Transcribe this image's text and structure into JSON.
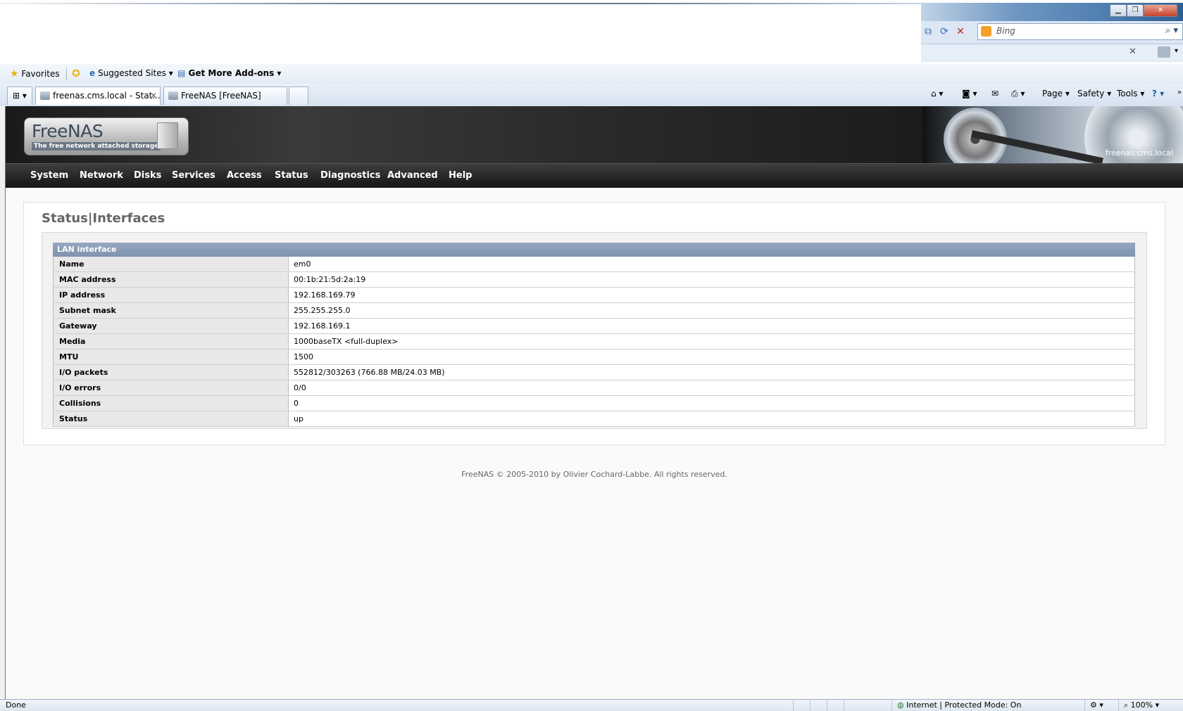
{
  "browser": {
    "search": {
      "placeholder": "Bing"
    },
    "favorites": {
      "favorites_label": "Favorites",
      "suggested_sites": "Suggested Sites",
      "get_addons": "Get More Add-ons"
    },
    "tabs": [
      {
        "label": "freenas.cms.local - Stat...",
        "close": "✕"
      },
      {
        "label": "FreeNAS [FreeNAS]"
      }
    ],
    "command_bar": {
      "page": "Page",
      "safety": "Safety",
      "tools": "Tools"
    },
    "status": {
      "left": "Done",
      "zone": "Internet | Protected Mode: On",
      "zoom": "100%"
    }
  },
  "app": {
    "logo_name": "FreeNAS",
    "logo_tagline": "The free network attached storage",
    "hostname": "freenas.cms.local",
    "nav": [
      "System",
      "Network",
      "Disks",
      "Services",
      "Access",
      "Status",
      "Diagnostics",
      "Advanced",
      "Help"
    ],
    "page_title": "Status|Interfaces",
    "table_title": "LAN interface",
    "rows": [
      {
        "key": "Name",
        "value": "em0"
      },
      {
        "key": "MAC address",
        "value": "00:1b:21:5d:2a:19"
      },
      {
        "key": "IP address",
        "value": "192.168.169.79"
      },
      {
        "key": "Subnet mask",
        "value": "255.255.255.0"
      },
      {
        "key": "Gateway",
        "value": "192.168.169.1"
      },
      {
        "key": "Media",
        "value": "1000baseTX <full-duplex>"
      },
      {
        "key": "MTU",
        "value": "1500"
      },
      {
        "key": "I/O packets",
        "value": "552812/303263 (766.88 MB/24.03 MB)"
      },
      {
        "key": "I/O errors",
        "value": "0/0"
      },
      {
        "key": "Collisions",
        "value": "0"
      },
      {
        "key": "Status",
        "value": "up"
      }
    ],
    "footer": "FreeNAS © 2005-2010 by Olivier Cochard-Labbe. All rights reserved."
  },
  "colors": {
    "nav_bg": "#1f1f1f",
    "table_header": "#8a9db8",
    "page_bg": "#fafafa"
  }
}
